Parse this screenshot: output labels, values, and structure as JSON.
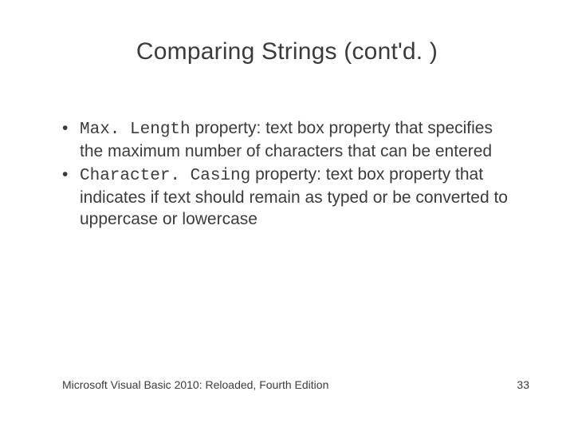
{
  "title": "Comparing Strings (cont'd. )",
  "bullets": [
    {
      "code": "Max. Length",
      "rest": " property: text box property that specifies the maximum number of characters that can be entered"
    },
    {
      "code": "Character. Casing",
      "rest": " property: text box property that indicates if text should remain as typed or be converted to uppercase or lowercase"
    }
  ],
  "footer": {
    "left": "Microsoft Visual Basic 2010: Reloaded, Fourth Edition",
    "right": "33"
  }
}
